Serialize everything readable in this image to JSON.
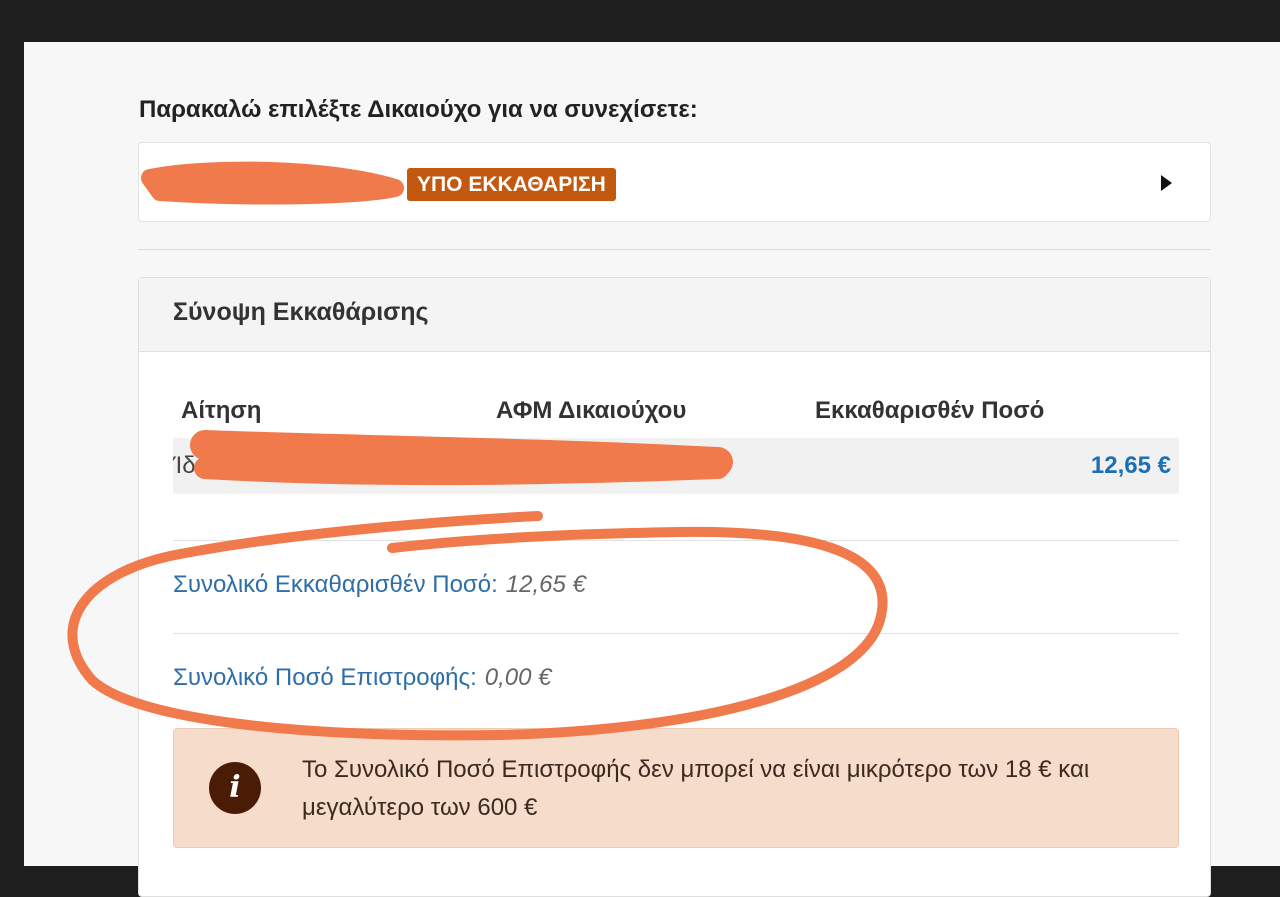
{
  "prompt": "Παρακαλώ επιλέξτε Δικαιούχο για να συνεχίσετε:",
  "beneficiary": {
    "status_badge": "ΥΠΟ ΕΚΚΑΘΑΡΙΣΗ"
  },
  "summary": {
    "title": "Σύνοψη Εκκαθάρισης",
    "columns": [
      "Αίτηση",
      "ΑΦΜ Δικαιούχου",
      "Εκκαθαρισθέν Ποσό"
    ],
    "row": {
      "request_prefix": "Ίδι",
      "amount": "12,65 €"
    },
    "total_cleared_label": "Συνολικό Εκκαθαρισθέν Ποσό:",
    "total_cleared_value": "12,65 €",
    "total_refund_label": "Συνολικό Ποσό Επιστροφής:",
    "total_refund_value": "0,00 €",
    "info_icon_glyph": "i",
    "notice": "Το Συνολικό Ποσό Επιστροφής δεν μπορεί να είναι μικρότερο των 18 € και μεγαλύτερο των 600 €"
  },
  "colors": {
    "badge": "#c2590f",
    "link": "#2f6ea7",
    "amount": "#1c6fb5",
    "annotation": "#f07a4b",
    "alert_bg": "#f6dccb"
  }
}
